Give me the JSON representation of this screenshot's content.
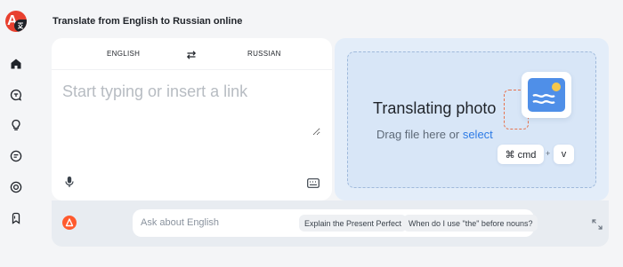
{
  "sidebar": {
    "logo_letter": "A",
    "items": [
      {
        "icon": "home-icon"
      },
      {
        "icon": "chat-translate-icon"
      },
      {
        "icon": "lightbulb-icon"
      },
      {
        "icon": "text-bubble-icon"
      },
      {
        "icon": "target-icon"
      },
      {
        "icon": "bookmark-icon"
      }
    ]
  },
  "page": {
    "title": "Translate from English to Russian online"
  },
  "translator": {
    "source_lang": "ENGLISH",
    "target_lang": "RUSSIAN",
    "input_placeholder": "Start typing or insert a link",
    "input_value": ""
  },
  "photo": {
    "title": "Translating photo",
    "hint_prefix": "Drag file here or ",
    "hint_link": "select",
    "shortcut_key1": "⌘ cmd",
    "shortcut_plus": "+",
    "shortcut_key2": "v"
  },
  "ask": {
    "placeholder": "Ask about English",
    "chips": [
      "Explain the Present Perfect",
      "When do I use \"the\" before nouns?"
    ]
  },
  "colors": {
    "brand_red": "#e8402f",
    "accent_orange": "#ff5a2e",
    "link_blue": "#2d7be5",
    "drop_zone_bg": "#d8e6f7"
  }
}
